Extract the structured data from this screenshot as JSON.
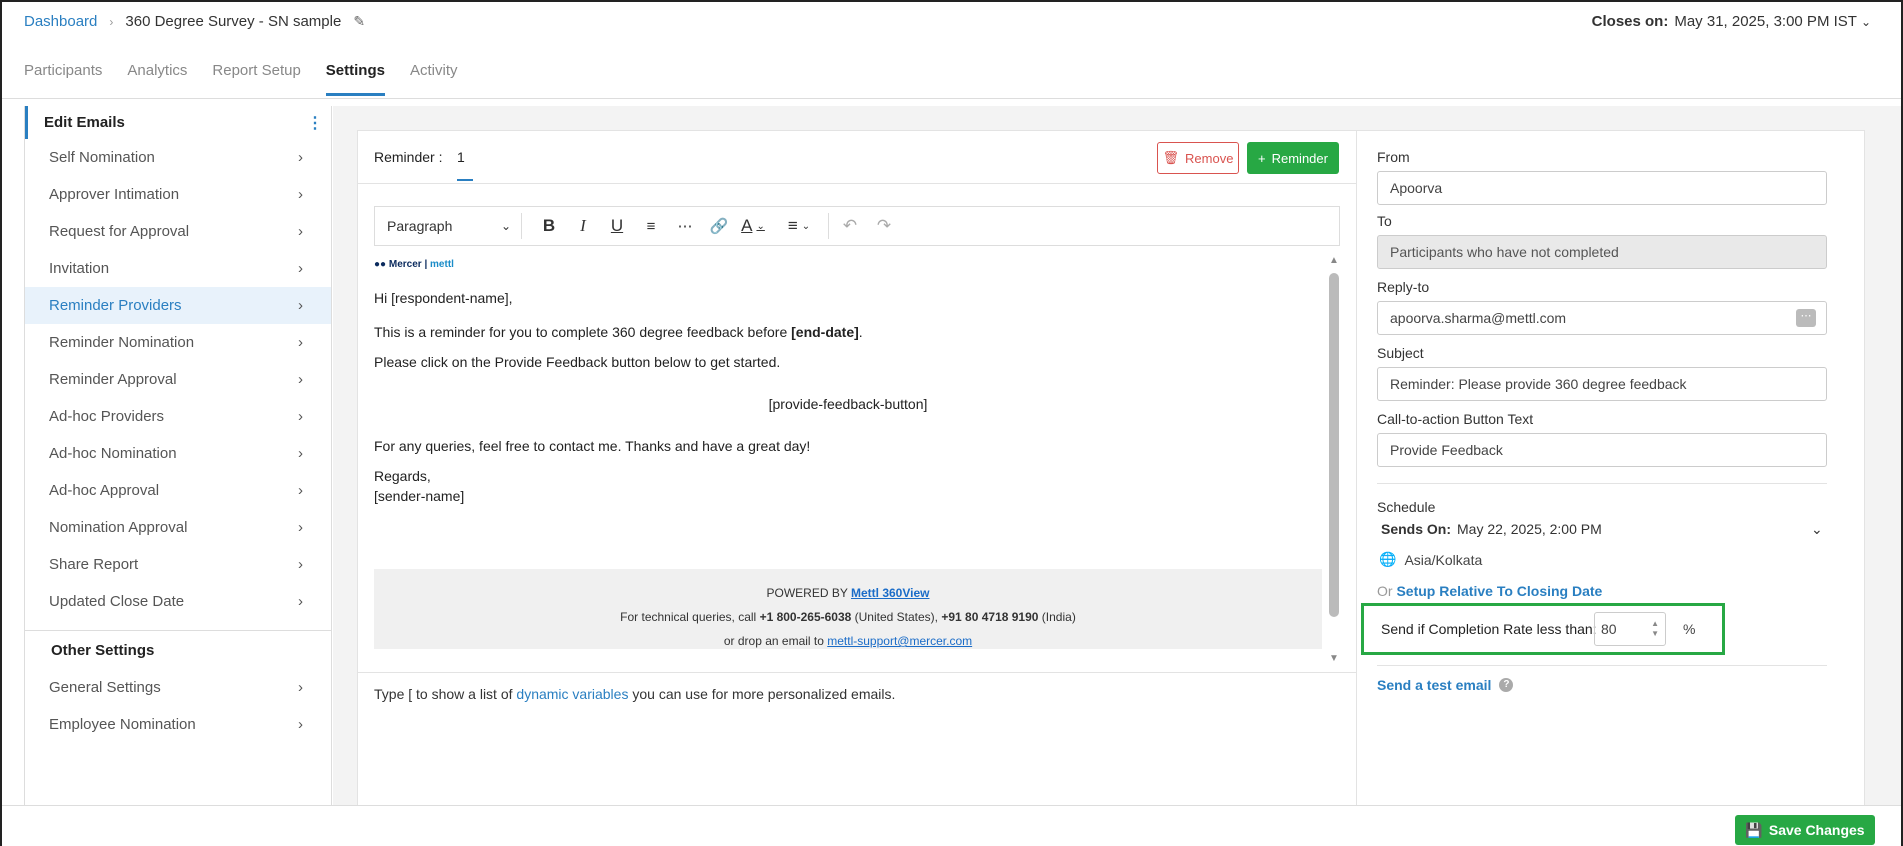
{
  "breadcrumb": {
    "home": "Dashboard",
    "title": "360 Degree Survey - SN sample"
  },
  "closes": {
    "label": "Closes on:",
    "value": "May 31, 2025, 3:00 PM IST"
  },
  "tabs": [
    "Participants",
    "Analytics",
    "Report Setup",
    "Settings",
    "Activity"
  ],
  "sidebar": {
    "header": "Edit Emails",
    "items": [
      "Self Nomination",
      "Approver Intimation",
      "Request for Approval",
      "Invitation",
      "Reminder Providers",
      "Reminder Nomination",
      "Reminder Approval",
      "Ad-hoc Providers",
      "Ad-hoc Nomination",
      "Ad-hoc Approval",
      "Nomination Approval",
      "Share Report",
      "Updated Close Date"
    ],
    "active_index": 4,
    "other_header": "Other Settings",
    "other_items": [
      "General Settings",
      "Employee Nomination"
    ]
  },
  "editor": {
    "reminder_label": "Reminder :",
    "reminder_number": "1",
    "remove_label": "Remove",
    "add_reminder_label": "Reminder",
    "paragraph_label": "Paragraph",
    "logo_text_1": "Mercer",
    "logo_text_2": "mettl",
    "greeting": "Hi [respondent-name],",
    "line1_prefix": "This is a reminder for you to complete 360 degree feedback before ",
    "line1_bold": "[end-date]",
    "line1_suffix": ".",
    "line2": "Please click on the Provide Feedback button below to get started.",
    "button_placeholder": "[provide-feedback-button]",
    "line3": "For any queries, feel free to contact me. Thanks and have a great day!",
    "regards": "Regards,",
    "sender": "[sender-name]",
    "footer_powered": "POWERED BY ",
    "footer_brand": "Mettl 360View",
    "footer_line2_prefix": "For technical queries, call ",
    "footer_us_phone": "+1 800-265-6038",
    "footer_us": " (United States), ",
    "footer_in_phone": "+91 80 4718 9190",
    "footer_in": " (India)",
    "footer_line3_prefix": "or drop an email to ",
    "footer_email": "mettl-support@mercer.com",
    "hint_prefix": "Type [ to show a list of ",
    "hint_link": "dynamic variables",
    "hint_suffix": " you can use for more personalized emails."
  },
  "form": {
    "from_label": "From",
    "from_value": "Apoorva",
    "to_label": "To",
    "to_value": "Participants who have not completed",
    "replyto_label": "Reply-to",
    "replyto_value": "apoorva.sharma@mettl.com",
    "subject_label": "Subject",
    "subject_value": "Reminder: Please provide 360 degree feedback",
    "cta_label": "Call-to-action Button Text",
    "cta_value": "Provide Feedback",
    "schedule_label": "Schedule",
    "sends_on_label": "Sends On:",
    "sends_on_value": "May 22, 2025, 2:00 PM",
    "timezone": "Asia/Kolkata",
    "setup_prefix": "Or ",
    "setup_link": "Setup Relative To Closing Date",
    "rate_label": "Send if Completion Rate less than:",
    "rate_value": "80",
    "rate_unit": "%",
    "test_email": "Send a test email"
  },
  "save_label": "Save Changes",
  "colors": {
    "accent": "#2a7fc1",
    "green": "#27a844",
    "danger": "#d9534f"
  }
}
